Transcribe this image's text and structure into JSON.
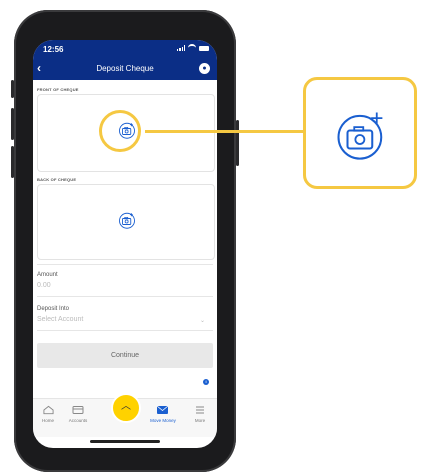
{
  "status_bar": {
    "time": "12:56"
  },
  "header": {
    "title": "Deposit Cheque",
    "back_icon": "chevron-left-icon",
    "chat_icon": "chat-icon"
  },
  "front": {
    "label": "FRONT OF CHEQUE",
    "icon": "camera-plus-icon"
  },
  "back": {
    "label": "BACK OF CHEQUE",
    "icon": "camera-plus-icon"
  },
  "amount": {
    "label": "Amount",
    "value": "0.00"
  },
  "deposit_into": {
    "label": "Deposit Into",
    "placeholder": "Select Account"
  },
  "continue_label": "Continue",
  "tabbar": {
    "items": [
      {
        "label": "Home",
        "icon": "home-icon"
      },
      {
        "label": "Accounts",
        "icon": "card-icon"
      },
      {
        "label": "",
        "icon": "chevron-up-icon"
      },
      {
        "label": "Move Money",
        "icon": "envelope-money-icon"
      },
      {
        "label": "More",
        "icon": "menu-icon"
      }
    ]
  },
  "colors": {
    "brand_blue": "#0b2e86",
    "accent_yellow": "#f5c842",
    "fab_yellow": "#ffd200",
    "active_blue": "#1a5fd0"
  }
}
